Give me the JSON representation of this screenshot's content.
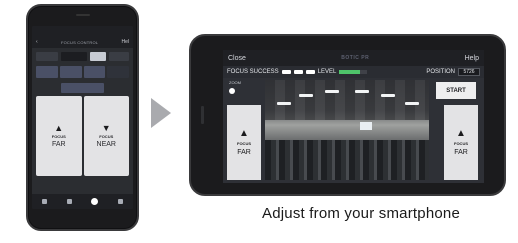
{
  "portrait_phone": {
    "header_title": "FOCUS CONTROL",
    "header_back": "‹",
    "header_right": "Hel",
    "focus_far": {
      "small": "FOCUS",
      "large": "FAR",
      "icon": "arrow-up-icon"
    },
    "focus_near": {
      "small": "FOCUS",
      "large": "NEAR",
      "icon": "arrow-down-icon"
    },
    "tabbar_icons": [
      "grid-icon",
      "adjust-icon",
      "camera-icon",
      "settings-icon"
    ]
  },
  "arrow": {
    "icon": "chevron-right-icon"
  },
  "landscape_phone": {
    "close_label": "Close",
    "help_label": "Help",
    "brand": "BOTIC PR",
    "status": {
      "focus_success_label": "FOCUS SUCCESS",
      "level_label": "LEVEL",
      "level_value": 0.75,
      "position_label": "POSITION",
      "position_value": "5726"
    },
    "zoom_label": "ZOOM",
    "start_label": "START",
    "focus_far_left": {
      "small": "FOCUS",
      "large": "FAR",
      "icon": "arrow-up-icon"
    },
    "focus_far_right": {
      "small": "FOCUS",
      "large": "FAR",
      "icon": "arrow-up-icon"
    }
  },
  "caption": "Adjust from your smartphone",
  "colors": {
    "accent_green": "#4ec36a",
    "button_bg": "#e3e3e5",
    "screen_bg": "#2e3036"
  }
}
